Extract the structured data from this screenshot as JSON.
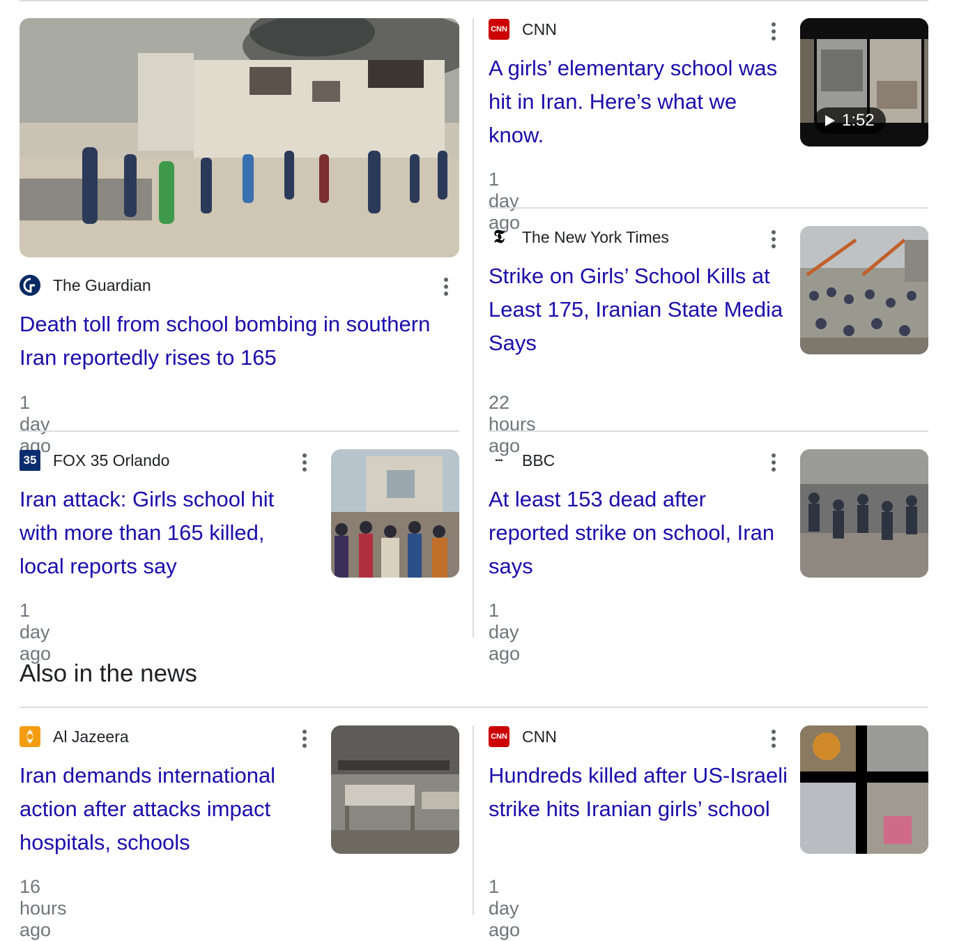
{
  "stories": [
    {
      "source": "The Guardian",
      "logo_text": "",
      "logo_color": "#052962",
      "title": "Death toll from school bombing in southern Iran reportedly rises to 165",
      "time": "1 day ago",
      "image": "school-ruins-crowd"
    },
    {
      "source": "CNN",
      "logo_text": "CNN",
      "logo_color": "#cc0000",
      "title": "A girls’ elementary school was hit in Iran. Here’s what we know.",
      "time": "1 day ago",
      "image": "video-collage",
      "video_duration": "1:52"
    },
    {
      "source": "The New York Times",
      "logo_text": "𝕿",
      "logo_color": "#000000",
      "title": "Strike on Girls’ School Kills at Least 175, Iranian State Media Says",
      "time": "22 hours ago",
      "image": "crowd-rubble-cranes"
    },
    {
      "source": "FOX 35 Orlando",
      "logo_text": "35",
      "logo_color": "#0a2d6e",
      "title": "Iran attack: Girls school hit with more than 165 killed, local reports say",
      "time": "1 day ago",
      "image": "crowd-ruined-building"
    },
    {
      "source": "BBC",
      "logo_text": "▪▪▪",
      "logo_color": "#000000",
      "title": "At least 153 dead after reported strike on school, Iran says",
      "time": "1 day ago",
      "image": "rubble-rescuers"
    }
  ],
  "also_heading": "Also in the news",
  "also_stories": [
    {
      "source": "Al Jazeera",
      "logo_text": "",
      "logo_color": "#f39c12",
      "title": "Iran demands international action after attacks impact hospitals, schools",
      "time": "16 hours ago",
      "image": "damaged-hospital-beds"
    },
    {
      "source": "CNN",
      "logo_text": "CNN",
      "logo_color": "#cc0000",
      "title": "Hundreds killed after US-Israeli strike hits Iranian girls’ school",
      "time": "1 day ago",
      "image": "photo-grid"
    }
  ]
}
